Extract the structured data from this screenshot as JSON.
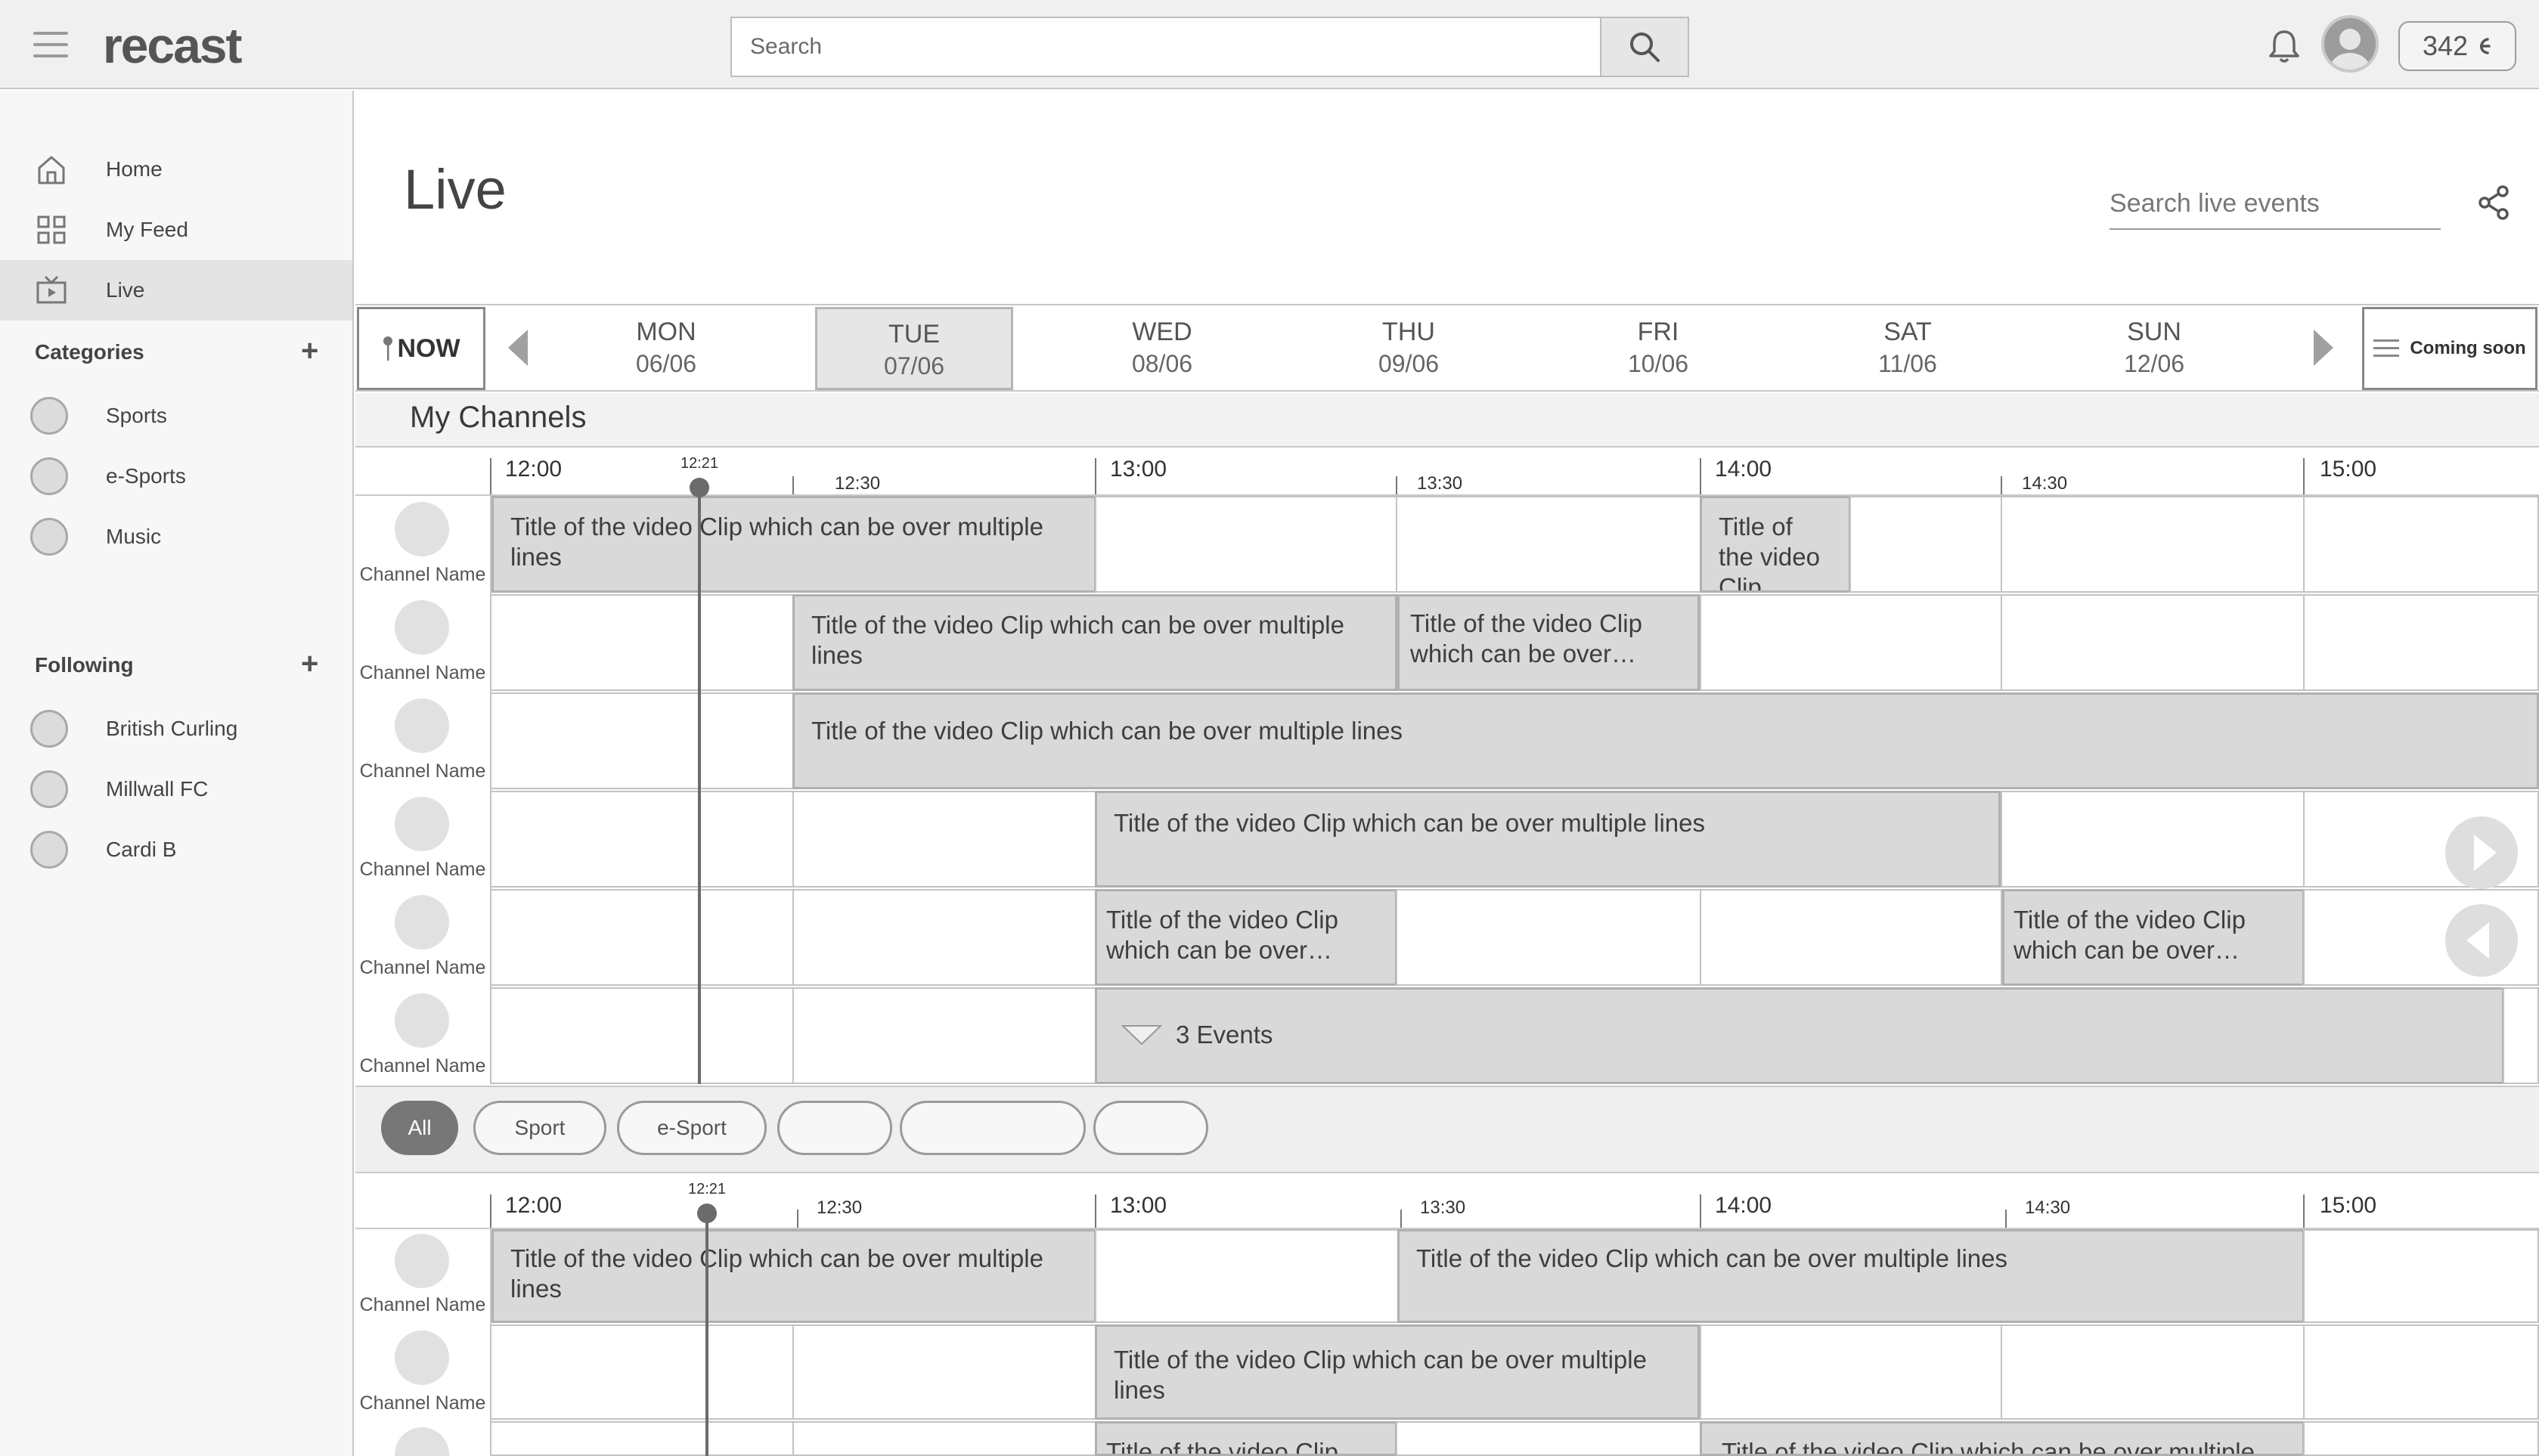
{
  "app": {
    "logo": "recast"
  },
  "header": {
    "search_placeholder": "Search",
    "credits": "342"
  },
  "sidebar": {
    "nav": [
      {
        "label": "Home",
        "icon": "home-icon"
      },
      {
        "label": "My Feed",
        "icon": "grid-icon"
      },
      {
        "label": "Live",
        "icon": "tv-icon",
        "active": true
      }
    ],
    "categories_title": "Categories",
    "categories": [
      "Sports",
      "e-Sports",
      "Music"
    ],
    "following_title": "Following",
    "following": [
      "British Curling",
      "Millwall FC",
      "Cardi B"
    ]
  },
  "page": {
    "title": "Live",
    "search_placeholder": "Search live events"
  },
  "days": {
    "now_label": "NOW",
    "items": [
      {
        "name": "MON",
        "date": "06/06"
      },
      {
        "name": "TUE",
        "date": "07/06",
        "selected": true
      },
      {
        "name": "WED",
        "date": "08/06"
      },
      {
        "name": "THU",
        "date": "09/06"
      },
      {
        "name": "FRI",
        "date": "10/06"
      },
      {
        "name": "SAT",
        "date": "11/06"
      },
      {
        "name": "SUN",
        "date": "12/06"
      }
    ],
    "coming_soon": "Coming soon"
  },
  "my_channels": {
    "title": "My Channels"
  },
  "timeline": {
    "major": [
      "12:00",
      "13:00",
      "14:00",
      "15:00"
    ],
    "minor": [
      "12:30",
      "13:30",
      "14:30"
    ],
    "now_time": "12:21"
  },
  "channel_name": "Channel Name",
  "events": {
    "long": "Title of the video Clip which can be over multiple lines",
    "short": "Title of the video Clip",
    "truncated": "Title of the video Clip which can be over…",
    "group": "3 Events",
    "cut1": "Title of the video Clip",
    "cut2": "Title of the video Clip which can be over multiple"
  },
  "filters": {
    "chips": [
      "All",
      "Sport",
      "e-Sport",
      "",
      "",
      ""
    ]
  },
  "colors": {
    "event_fill": "#d9d9d9",
    "now_line": "#6b6b6b",
    "active_chip": "#777777"
  }
}
